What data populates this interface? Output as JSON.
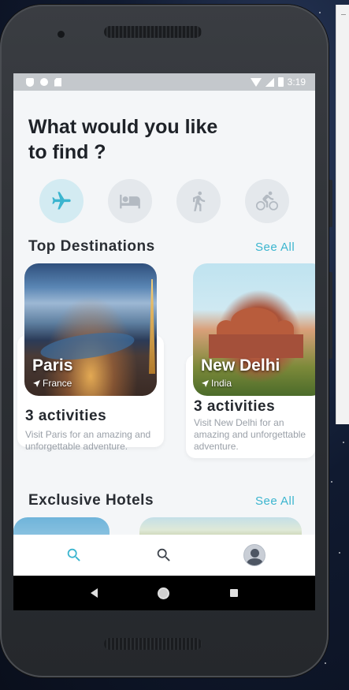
{
  "status_bar": {
    "time": "3:19"
  },
  "header": {
    "title": "What would you like to find ?"
  },
  "categories": [
    {
      "icon": "airplane-icon",
      "active": true
    },
    {
      "icon": "bed-icon",
      "active": false
    },
    {
      "icon": "walking-icon",
      "active": false
    },
    {
      "icon": "bicycle-icon",
      "active": false
    }
  ],
  "top_destinations": {
    "title": "Top Destinations",
    "see_all": "See All",
    "cards": [
      {
        "city": "Paris",
        "country": "France",
        "activities": "3 activities",
        "description": "Visit Paris for an amazing and unforgettable adventure."
      },
      {
        "city": "New Delhi",
        "country": "India",
        "activities": "3 activities",
        "description": "Visit New Delhi for an amazing and unforgettable adventure."
      }
    ]
  },
  "exclusive_hotels": {
    "title": "Exclusive Hotels",
    "see_all": "See All"
  },
  "bottom_nav": [
    {
      "icon": "search-icon",
      "active": true
    },
    {
      "icon": "search-icon",
      "active": false
    },
    {
      "icon": "profile-avatar",
      "active": false
    }
  ],
  "colors": {
    "accent": "#3bb5cf",
    "background": "#f4f6f8",
    "title": "#1e2228"
  }
}
